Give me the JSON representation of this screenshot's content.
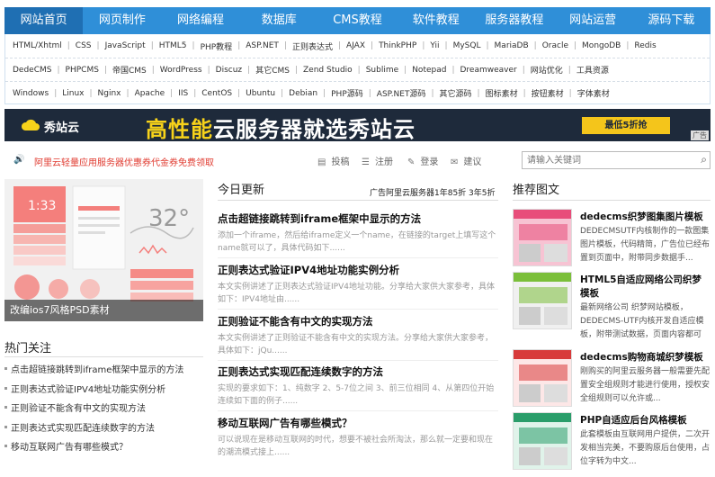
{
  "nav": [
    "网站首页",
    "网页制作",
    "网络编程",
    "数据库",
    "CMS教程",
    "软件教程",
    "服务器教程",
    "网站运营",
    "源码下载"
  ],
  "tags": [
    [
      "HTML/Xhtml",
      "CSS",
      "JavaScript",
      "HTML5",
      "PHP教程",
      "ASP.NET",
      "正则表达式",
      "AJAX",
      "ThinkPHP",
      "Yii",
      "MySQL",
      "MariaDB",
      "Oracle",
      "MongoDB",
      "Redis"
    ],
    [
      "DedeCMS",
      "PHPCMS",
      "帝国CMS",
      "WordPress",
      "Discuz",
      "其它CMS",
      "Zend Studio",
      "Sublime",
      "Notepad",
      "Dreamweaver",
      "网站优化",
      "工具资源"
    ],
    [
      "Windows",
      "Linux",
      "Nginx",
      "Apache",
      "IIS",
      "CentOS",
      "Ubuntu",
      "Debian",
      "PHP源码",
      "ASP.NET源码",
      "其它源码",
      "图标素材",
      "按钮素材",
      "字体素材"
    ]
  ],
  "banner": {
    "logo": "秀站云",
    "slogan_hl": "高性能",
    "slogan_rest": "云服务器就选秀站云",
    "cta": "最低5折抢",
    "ad_tag": "广告"
  },
  "notice": {
    "text": "阿里云轻量应用服务器优惠券代金券免费领取",
    "actions": {
      "post": "投稿",
      "register": "注册",
      "login": "登录",
      "suggest": "建议"
    },
    "search_placeholder": "请输入关键词"
  },
  "hero": {
    "caption": "改编ios7风格PSD素材",
    "time": "1:33",
    "temp": "32°"
  },
  "hot": {
    "title": "热门关注",
    "items": [
      "点击超链接跳转到iframe框架中显示的方法",
      "正则表达式验证IPV4地址功能实例分析",
      "正则验证不能含有中文的实现方法",
      "正则表达式实现匹配连续数字的方法",
      "移动互联网广告有哪些模式？"
    ]
  },
  "today": {
    "title": "今日更新",
    "aux": "广告阿里云服务器1年85折 3年5折",
    "articles": [
      {
        "title": "点击超链接跳转到iframe框架中显示的方法",
        "desc": "添加一个iframe，然后给iframe定义一个name，在链接的target上填写这个name就可以了，具体代码如下......"
      },
      {
        "title": "正则表达式验证IPV4地址功能实例分析",
        "desc": "本文实例讲述了正则表达式验证IPV4地址功能。分享给大家供大家参考，具体如下：IPV4地址由......"
      },
      {
        "title": "正则验证不能含有中文的实现方法",
        "desc": "本文实例讲述了正则验证不能含有中文的实现方法。分享给大家供大家参考，具体如下：jQu......"
      },
      {
        "title": "正则表达式实现匹配连续数字的方法",
        "desc": "实现的要求如下：1、纯数字 2、5-7位之间 3、前三位相同 4、从第四位开始连续如下面的例子......"
      },
      {
        "title": "移动互联网广告有哪些模式？",
        "desc": "可以说现在是移动互联网的时代，想要不被社会所淘汰，那么就一定要和现在的潮流模式接上......"
      }
    ]
  },
  "pics": {
    "title": "推荐图文",
    "items": [
      {
        "title": "dedecms织梦图集图片模板",
        "desc": "DEDECMSUTF内核制作的一款图集图片模板，代码精简，广告位已经布置到页面中，附带同步数据手..."
      },
      {
        "title": "HTML5自适应网络公司织梦模板",
        "desc": "最新网络公司 织梦网站模板，DEDECMS-UTF内核开发自适应模板，附带测试数据，页面内容都可以..."
      },
      {
        "title": "dedecms购物商城织梦模板",
        "desc": "刚购买的阿里云服务器一般需要先配置安全组规则才能进行使用，授权安全组规则可以允许或..."
      },
      {
        "title": "PHP自适应后台风格模板",
        "desc": "此套模板由互联网用户提供，二次开发相当完美，不要购原后台使用，占位字转为中文..."
      }
    ]
  },
  "colors": {
    "nav": "#2f8fd8",
    "nav_active": "#1f6fb3",
    "notice": "#e03a2f",
    "banner_bg": "#1e2a3b",
    "accent": "#f7d21a"
  }
}
